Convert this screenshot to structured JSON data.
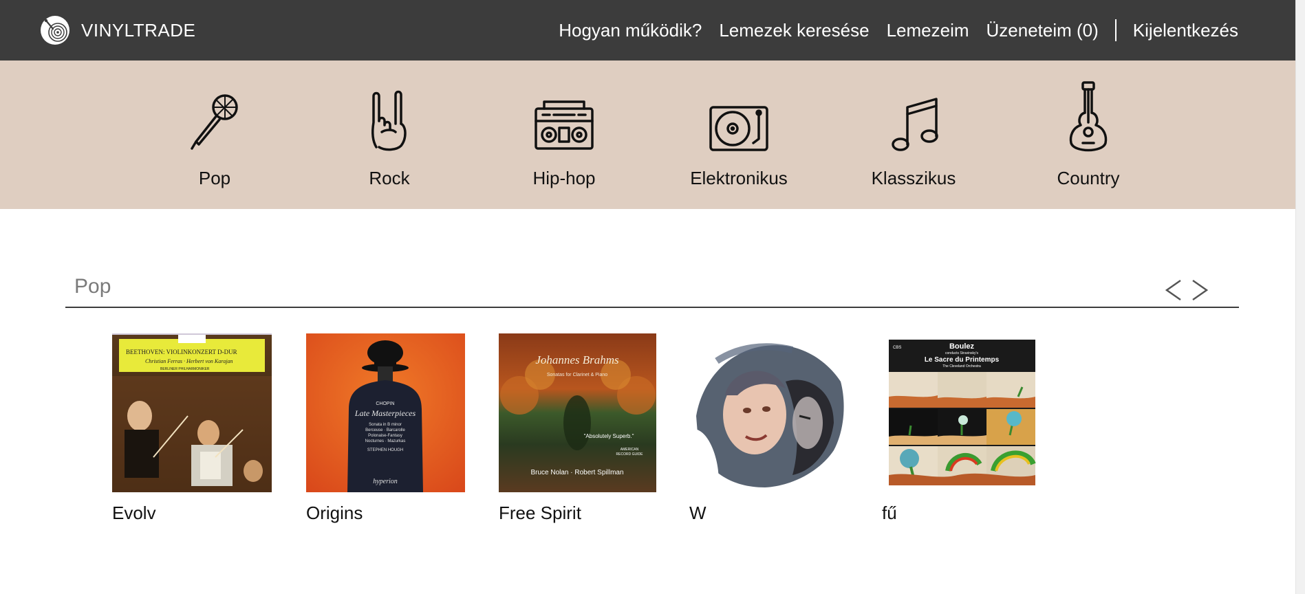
{
  "brand": {
    "name": "VINYLTRADE",
    "logo_icon": "vinyl-record-icon"
  },
  "nav": {
    "how_it_works": "Hogyan működik?",
    "search_records": "Lemezek keresése",
    "my_records": "Lemezeim",
    "messages": "Üzeneteim (0)",
    "logout": "Kijelentkezés"
  },
  "genres": [
    {
      "label": "Pop",
      "icon": "microphone-icon"
    },
    {
      "label": "Rock",
      "icon": "rock-hand-icon"
    },
    {
      "label": "Hip-hop",
      "icon": "boombox-icon"
    },
    {
      "label": "Elektronikus",
      "icon": "turntable-icon"
    },
    {
      "label": "Klasszikus",
      "icon": "music-note-icon"
    },
    {
      "label": "Country",
      "icon": "guitar-icon"
    }
  ],
  "section": {
    "title": "Pop",
    "prev_icon": "chevron-left-icon",
    "next_icon": "chevron-right-icon"
  },
  "records": [
    {
      "title": "Evolv",
      "cover": {
        "line1": "BEETHOVEN: VIOLINKONZERT D-DUR",
        "line2": "Christian Ferras · Herbert von Karajan",
        "line3": "BERLINER PHILHARMONIKER"
      }
    },
    {
      "title": "Origins",
      "cover": {
        "composer": "CHOPIN",
        "album": "Late Masterpieces",
        "tracks": [
          "Sonata in B minor",
          "Berceuse · Barcarolle",
          "Polonaise-Fantasy",
          "Nocturnes · Mazurkas"
        ],
        "performer": "STEPHEN HOUGH",
        "label": "hyperion"
      }
    },
    {
      "title": "Free Spirit",
      "cover": {
        "composer": "Johannes Brahms",
        "subtitle": "Sonatas for Clarinet & Piano",
        "quote": "\"Absolutely Superb.\"",
        "quote_source_1": "AMERICAN",
        "quote_source_2": "RECORD GUIDE",
        "artists": "Bruce Nolan · Robert Spillman"
      }
    },
    {
      "title": "W",
      "cover": {}
    },
    {
      "title": "fű",
      "cover": {
        "label": "CBS",
        "line1": "Boulez",
        "line2": "conducts Stravinsky's",
        "line3": "Le Sacre du Printemps",
        "line4": "The Cleveland Orchestra"
      }
    }
  ],
  "colors": {
    "topbar": "#3c3c3c",
    "genrebar": "#dfcec1",
    "section_title": "#7a7a7a"
  }
}
